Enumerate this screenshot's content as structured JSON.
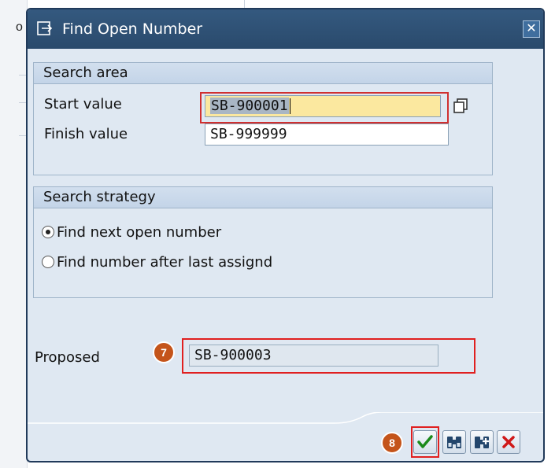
{
  "dialog": {
    "title": "Find Open Number",
    "close_symbol": "✕"
  },
  "search_area": {
    "header": "Search area",
    "start_label": "Start value",
    "start_value": "SB-900001",
    "finish_label": "Finish value",
    "finish_value": "SB-999999"
  },
  "search_strategy": {
    "header": "Search strategy",
    "options": [
      {
        "label": "Find next open number",
        "selected": true
      },
      {
        "label": "Find number after last assignd",
        "selected": false
      }
    ]
  },
  "proposed": {
    "label": "Proposed",
    "value": "SB-900003"
  },
  "annotations": {
    "step7": "7",
    "step8": "8"
  },
  "background": {
    "edge_char": "o"
  },
  "toolbar": {
    "icons": [
      "check-icon",
      "find-icon",
      "find-next-icon",
      "cancel-icon"
    ]
  },
  "colors": {
    "title_bar": "#2f5377",
    "dialog_bg": "#dfe8f2",
    "active_field": "#fbe89f",
    "highlight": "#e02020",
    "badge": "#c4541a"
  }
}
